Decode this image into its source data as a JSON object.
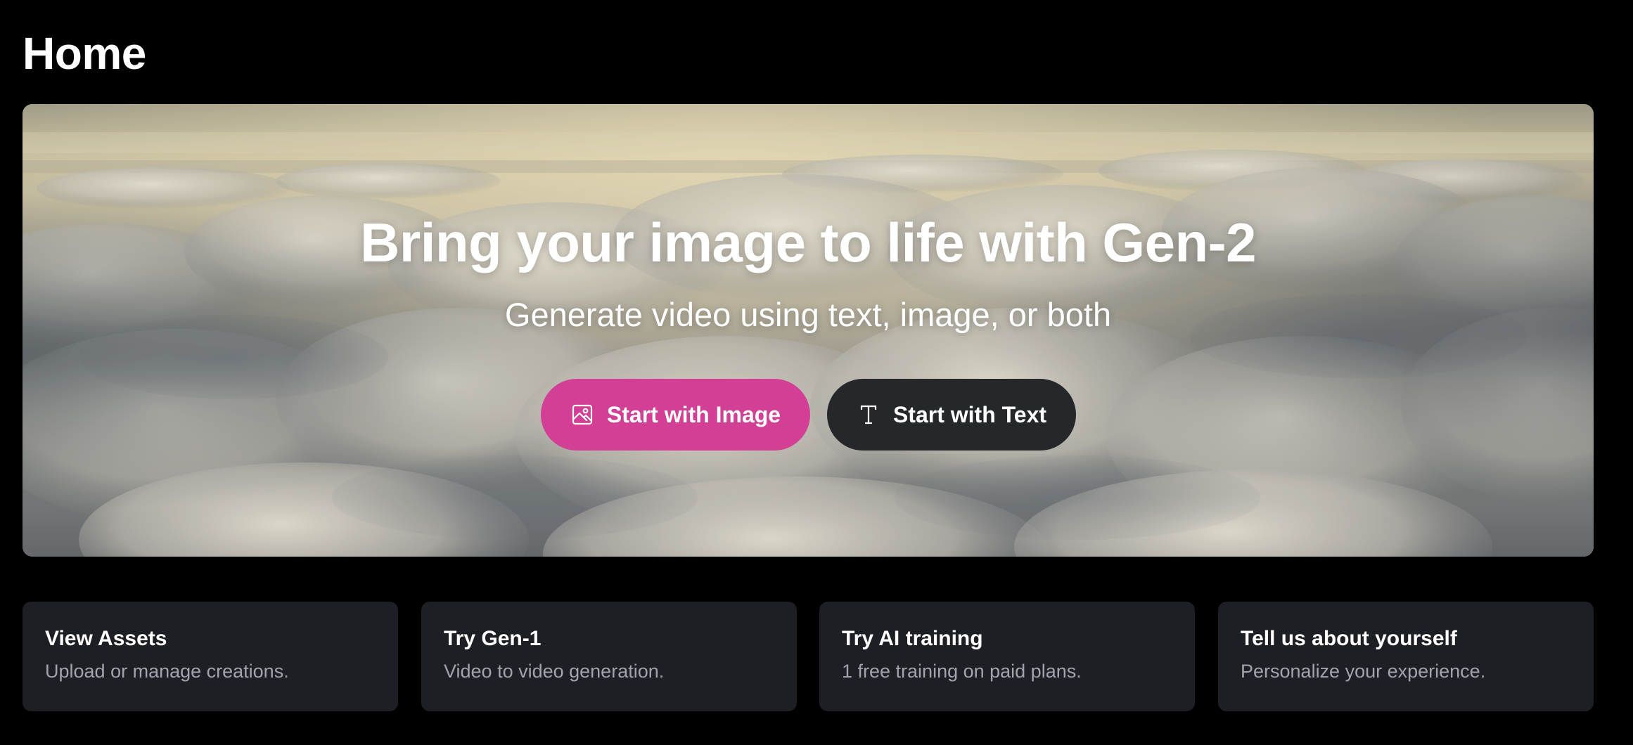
{
  "page": {
    "title": "Home"
  },
  "hero": {
    "title": "Bring your image to life with Gen-2",
    "subtitle": "Generate video using text, image, or both",
    "background": "clouds-image",
    "buttons": [
      {
        "label": "Start with Image",
        "icon": "image-icon",
        "color": "#d23f95"
      },
      {
        "label": "Start with Text",
        "icon": "text-icon",
        "color": "#26272b"
      }
    ]
  },
  "cards": [
    {
      "title": "View Assets",
      "description": "Upload or manage creations."
    },
    {
      "title": "Try Gen-1",
      "description": "Video to video generation."
    },
    {
      "title": "Try AI training",
      "description": "1 free training on paid plans."
    },
    {
      "title": "Tell us about yourself",
      "description": "Personalize your experience."
    }
  ],
  "colors": {
    "background": "#000000",
    "card": "#1e1f24",
    "accent": "#d23f95",
    "secondary_button": "#26272b",
    "muted_text": "#a2a4ad"
  }
}
